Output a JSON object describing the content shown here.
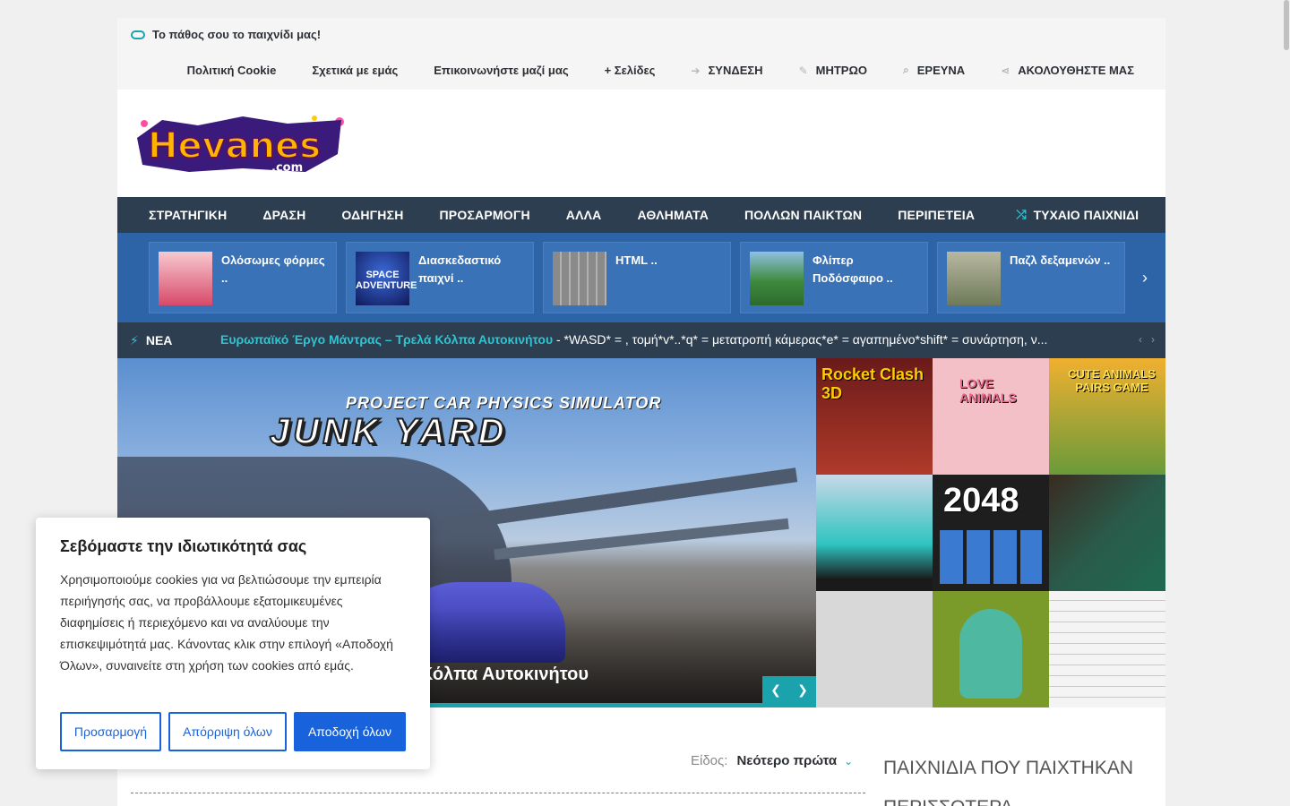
{
  "topbar": {
    "tagline": "Το πάθος σου το παιχνίδι μας!",
    "links": [
      {
        "label": "Πολιτική Cookie",
        "icon": ""
      },
      {
        "label": "Σχετικά με εμάς",
        "icon": ""
      },
      {
        "label": "Επικοινωνήστε μαζί μας",
        "icon": ""
      },
      {
        "label": "+ Σελίδες",
        "icon": ""
      },
      {
        "label": "ΣΥΝΔΕΣΗ",
        "icon": "login-icon"
      },
      {
        "label": "ΜΗΤΡΩΟ",
        "icon": "register-icon"
      },
      {
        "label": "ΕΡΕΥΝΑ",
        "icon": "search-icon"
      },
      {
        "label": "ΑΚΟΛΟΥΘΗΣΤΕ ΜΑΣ",
        "icon": "share-icon"
      }
    ]
  },
  "logo": {
    "text": "Hevanes",
    "sub": ".com"
  },
  "nav": {
    "items": [
      "ΣΤΡΑΤΗΓΙΚΗ",
      "ΔΡΑΣΗ",
      "ΟΔΗΓΗΣΗ",
      "ΠΡΟΣΑΡΜΟΓΗ",
      "ΑΛΛΑ",
      "ΑΘΛΗΜΑΤΑ",
      "ΠΟΛΛΩΝ ΠΑΙΚΤΩΝ",
      "ΠΕΡΙΠΕΤΕΙΑ"
    ],
    "random": "ΤΥΧΑΙΟ ΠΑΙΧΝΙΔΙ"
  },
  "slider": {
    "cards": [
      {
        "title": "Ολόσωμες φόρμες ..",
        "color": "#d84a6a"
      },
      {
        "title": "Διασκεδαστικό παιχνί ..",
        "color": "#243a9c"
      },
      {
        "title": "HTML ..",
        "color": "#7a8a7a"
      },
      {
        "title": "Φλίπερ Ποδόσφαιρο ..",
        "color": "#3e8a3e"
      },
      {
        "title": "Παζλ δεξαμενών ..",
        "color": "#6e7a5a"
      }
    ],
    "thumb_texts": [
      "",
      "SPACE ADVENTURE",
      "",
      "",
      ""
    ]
  },
  "ticker": {
    "label": "ΝΕΑ",
    "headline": "Ευρωπαϊκό Έργο Μάντρας – Τρελά Κόλπα Αυτοκινήτου",
    "text": " - *WASD* = , τομή*v*..*q* = μετατροπή κάμερας*e* = αγαπημένο*shift* = συνάρτηση, ν..."
  },
  "hero": {
    "sub": "PROJECT CAR PHYSICS SIMULATOR",
    "title": "JUNK YARD",
    "caption": "ά Κόλπα Αυτοκινήτου"
  },
  "grid": {
    "tiles": [
      {
        "label": "Rocket Clash 3D",
        "bg": "#b03a2a"
      },
      {
        "label": "LOVE ANIMALS",
        "bg": "#f3c0c8"
      },
      {
        "label": "CUTE ANIMALS PAIRS GAME",
        "bg": "#6a9a3a"
      },
      {
        "label": "",
        "bg": "#8fc0e0"
      },
      {
        "label": "2048",
        "bg": "#1e1e1e"
      },
      {
        "label": "",
        "bg": "#2a5a4a"
      },
      {
        "label": "",
        "bg": "#d8d8d8"
      },
      {
        "label": "",
        "bg": "#7a9a2a"
      },
      {
        "label": "",
        "bg": "#f4f4f4"
      }
    ]
  },
  "sort": {
    "label": "Είδος:",
    "value": "Νεότερο πρώτα"
  },
  "sidebar": {
    "title": "ΠΑΙΧΝΙΔΙΑ ΠΟΥ ΠΑΙΧΤΗΚΑΝ ΠΕΡΙΣΣΟΤΕΡΑ"
  },
  "cookie": {
    "title": "Σεβόμαστε την ιδιωτικότητά σας",
    "body": "Χρησιμοποιούμε cookies για να βελτιώσουμε την εμπειρία περιήγησής σας, να προβάλλουμε εξατομικευμένες διαφημίσεις ή περιεχόμενο και να αναλύουμε την επισκεψιμότητά μας. Κάνοντας κλικ στην επιλογή «Αποδοχή Όλων», συναινείτε στη χρήση των cookies από εμάς.",
    "customize": "Προσαρμογή",
    "reject": "Απόρριψη όλων",
    "accept": "Αποδοχή όλων"
  }
}
